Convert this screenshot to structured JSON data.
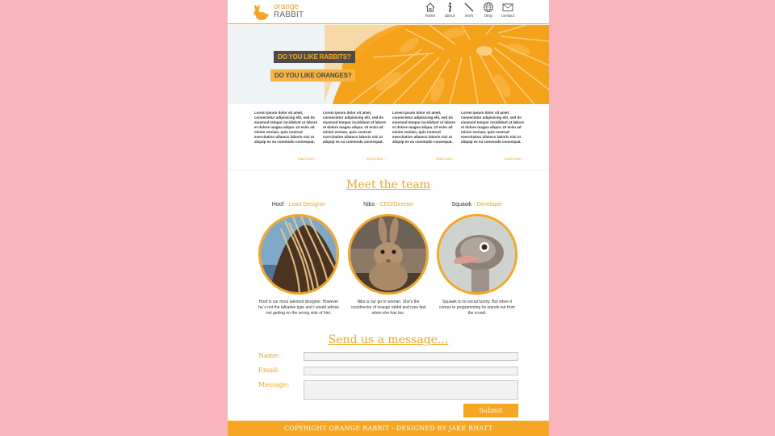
{
  "brand": {
    "line1": "orange",
    "line2": "RABBIT",
    "accent": "#f5a623",
    "background": "#f9b5bc"
  },
  "nav": [
    {
      "label": "home",
      "icon": "home-icon"
    },
    {
      "label": "about",
      "icon": "info-icon"
    },
    {
      "label": "work",
      "icon": "pencil-icon"
    },
    {
      "label": "blog",
      "icon": "globe-icon"
    },
    {
      "label": "contact",
      "icon": "envelope-icon"
    }
  ],
  "hero": {
    "question1": "DO YOU LIKE RABBITS?",
    "question2": "DO YOU LIKE ORANGES?"
  },
  "columns": [
    {
      "text": "Lorem ipsum dolor sit amet, consectetur adipisicing elit, sed do eiusmod tempor incididunt ut labore et dolore magna aliqua. Ut enim ad minim veniam, quis nostrud exercitation ullamco laboris nisi ut aliquip ex ea commodo consequat.",
      "link": "read more..."
    },
    {
      "text": "Lorem ipsum dolor sit amet, consectetur adipisicing elit, sed do eiusmod tempor incididunt ut labore et dolore magna aliqua. Ut enim ad minim veniam, quis nostrud exercitation ullamco laboris nisi ut aliquip ex ea commodo consequat.",
      "link": "read more..."
    },
    {
      "text": "Lorem ipsum dolor sit amet, consectetur adipisicing elit, sed do eiusmod tempor incididunt ut labore et dolore magna aliqua. Ut enim ad minim veniam, quis nostrud exercitation ullamco laboris nisi ut aliquip ex ea commodo consequat.",
      "link": "read more..."
    },
    {
      "text": "Lorem ipsum dolor sit amet, consectetur adipisicing elit, sed do eiusmod tempor incididunt ut labore et dolore magna aliqua. Ut enim ad minim veniam, quis nostrud exercitation ullamco laboris nisi ut aliquip ex ea commodo consequat.",
      "link": "read more..."
    }
  ],
  "team": {
    "title": "Meet the team",
    "members": [
      {
        "name": "Hoof",
        "sep": " - ",
        "role": "Lead Designer",
        "desc": "Hoof is our most talented designer. However he`s not the talkative type and I would advise not getting on the wrong side of him."
      },
      {
        "name": "Nibs",
        "sep": " - ",
        "role": "CEO/Director",
        "desc": "Nibs is our go to woman. She's the ceo/director of orange rabbit and runs fast when she has too."
      },
      {
        "name": "Squawk",
        "sep": " - ",
        "role": "Developer",
        "desc": "Squawk is no social bunny. But when it comes to programming he stands out from the crowd."
      }
    ]
  },
  "form": {
    "title": "Send us a message...",
    "name_label": "Name:",
    "email_label": "Email:",
    "message_label": "Message:",
    "submit_label": "Submit"
  },
  "footer": {
    "text": "COPYRIGHT ORANGE RABBIT - DESIGNED BY JAKE BHATT"
  }
}
